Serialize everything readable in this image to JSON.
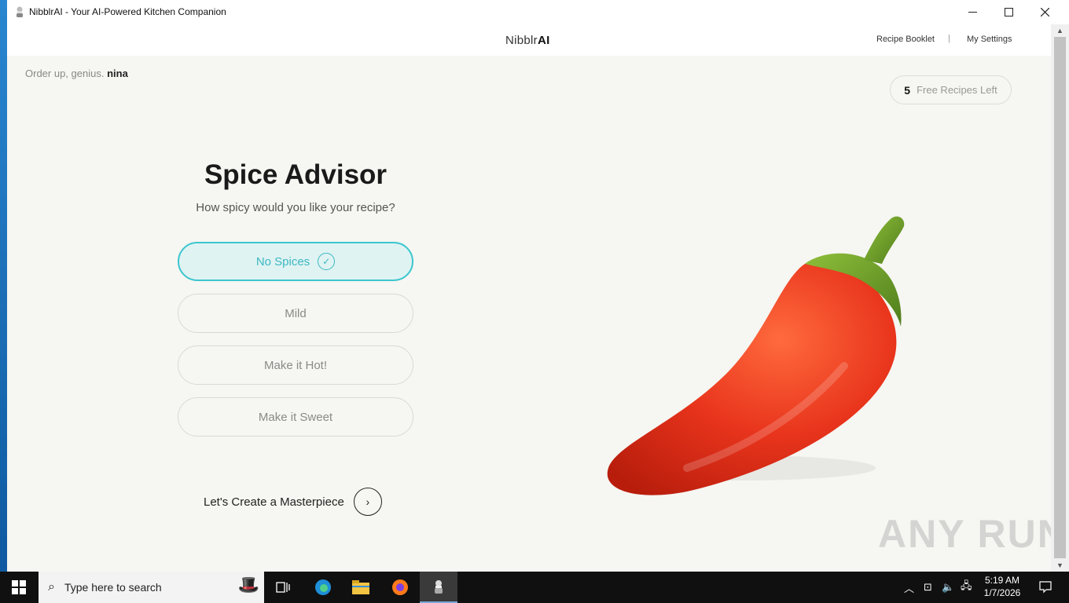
{
  "window": {
    "title": "NibblrAI - Your AI-Powered Kitchen Companion"
  },
  "header": {
    "brand_prefix": "Nibblr",
    "brand_suffix": "AI",
    "nav": {
      "recipe_booklet": "Recipe Booklet",
      "separator": "|",
      "my_settings": "My Settings"
    }
  },
  "greeting": {
    "prefix": "Order up, genius.",
    "user": "nina"
  },
  "free_recipes": {
    "count": "5",
    "label": "Free Recipes Left"
  },
  "spice_advisor": {
    "title": "Spice Advisor",
    "subtitle": "How spicy would you like your recipe?",
    "options": [
      {
        "label": "No Spices",
        "selected": true
      },
      {
        "label": "Mild",
        "selected": false
      },
      {
        "label": "Make it Hot!",
        "selected": false
      },
      {
        "label": "Make it Sweet",
        "selected": false
      }
    ],
    "accent_color": "#3cc6cf"
  },
  "create": {
    "label": "Let's Create a Masterpiece"
  },
  "illustration": {
    "icon": "chili-pepper-icon",
    "pepper_color": "#e8341c",
    "stem_color": "#6a9a2a"
  },
  "watermark": "ANY RUN",
  "taskbar": {
    "search_placeholder": "Type here to search",
    "time": "5:19 AM",
    "date": "1/7/2026"
  }
}
